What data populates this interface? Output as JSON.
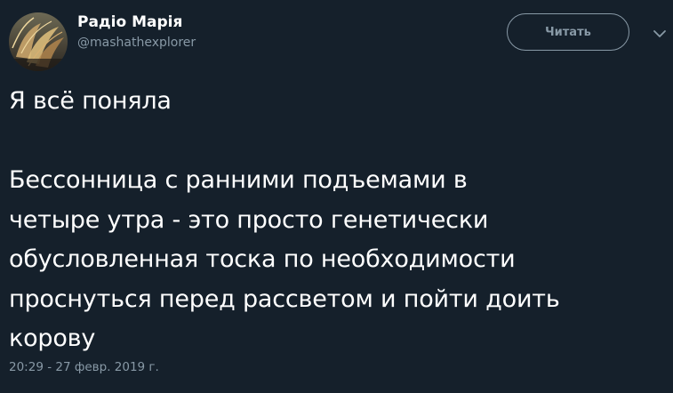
{
  "author": {
    "display_name": "Радіо Марія",
    "handle": "@mashathexplorer",
    "avatar_icon": "profile-photo"
  },
  "follow_button": {
    "label": "Читать"
  },
  "menu": {
    "icon": "chevron-down-icon"
  },
  "tweet": {
    "lines": [
      "Я всё поняла",
      "",
      "Бессонница с ранними подъемами в",
      "четыре утра - это просто генетически",
      "обусловленная тоска по необходимости",
      "проснуться перед рассветом и пойти доить",
      "корову"
    ],
    "timestamp": "20:29 - 27 февр. 2019 г."
  },
  "colors": {
    "background": "#15202b",
    "text": "#ffffff",
    "secondary": "#8899a6"
  }
}
